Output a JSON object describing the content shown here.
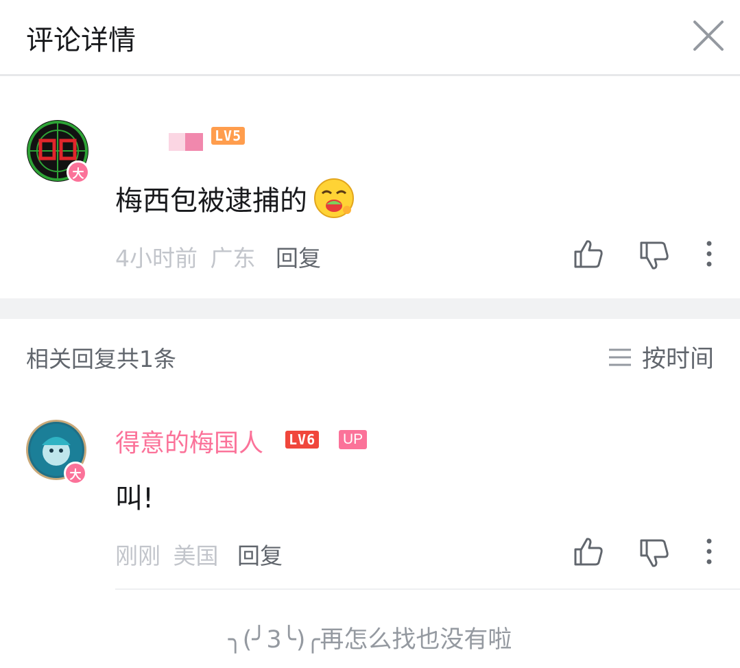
{
  "header": {
    "title": "评论详情"
  },
  "root_comment": {
    "level_badge": "LV5",
    "vip_badge": "大",
    "text": "梅西包被逮捕的",
    "time": "4小时前",
    "location": "广东",
    "reply_label": "回复"
  },
  "replies_section": {
    "count_label": "相关回复共1条",
    "sort_label": "按时间"
  },
  "reply_comment": {
    "username": "得意的梅国人",
    "level_badge": "LV6",
    "up_badge": "UP",
    "vip_badge": "大",
    "text": "叫!",
    "time": "刚刚",
    "location": "美国",
    "reply_label": "回复"
  },
  "footer": {
    "end_text": "╮(╯3╰)╭再怎么找也没有啦"
  },
  "colors": {
    "accent_pink": "#fb7299",
    "level5": "#ff9d4d",
    "level6": "#f0463b",
    "muted": "#c2c5cb"
  }
}
